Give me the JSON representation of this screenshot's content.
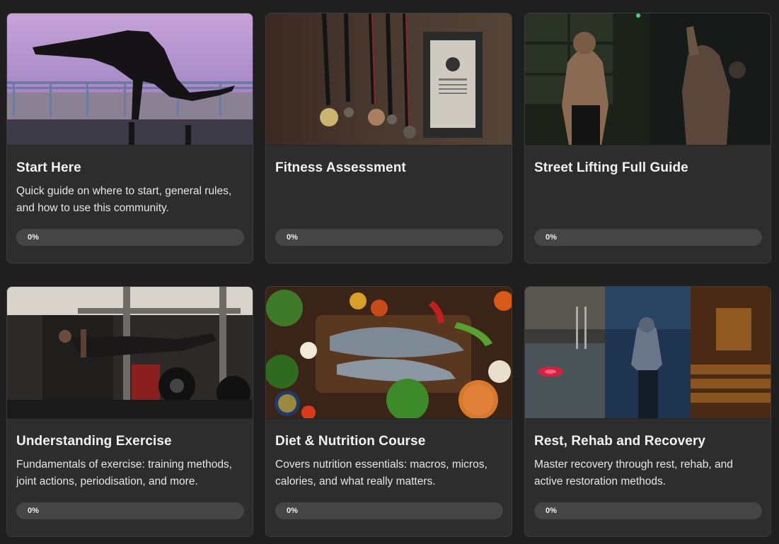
{
  "courses": [
    {
      "title": "Start Here",
      "description": "Quick guide on where to start, general rules, and how to use this community.",
      "progress_label": "0%",
      "progress": 0,
      "image_icon": "handstand-photo"
    },
    {
      "title": "Fitness Assessment",
      "description": "",
      "progress_label": "0%",
      "progress": 0,
      "image_icon": "medals-photo"
    },
    {
      "title": "Street Lifting Full Guide",
      "description": "",
      "progress_label": "0%",
      "progress": 0,
      "image_icon": "athlete-photo"
    },
    {
      "title": "Understanding Exercise",
      "description": "Fundamentals of exercise: training methods, joint actions, periodisation, and more.",
      "progress_label": "0%",
      "progress": 0,
      "image_icon": "gym-planche-photo"
    },
    {
      "title": "Diet & Nutrition Course",
      "description": "Covers nutrition essentials: macros, micros, calories, and what really matters.",
      "progress_label": "0%",
      "progress": 0,
      "image_icon": "food-photo"
    },
    {
      "title": "Rest, Rehab and Recovery",
      "description": "Master recovery through rest, rehab, and active restoration methods.",
      "progress_label": "0%",
      "progress": 0,
      "image_icon": "recovery-photo"
    }
  ]
}
